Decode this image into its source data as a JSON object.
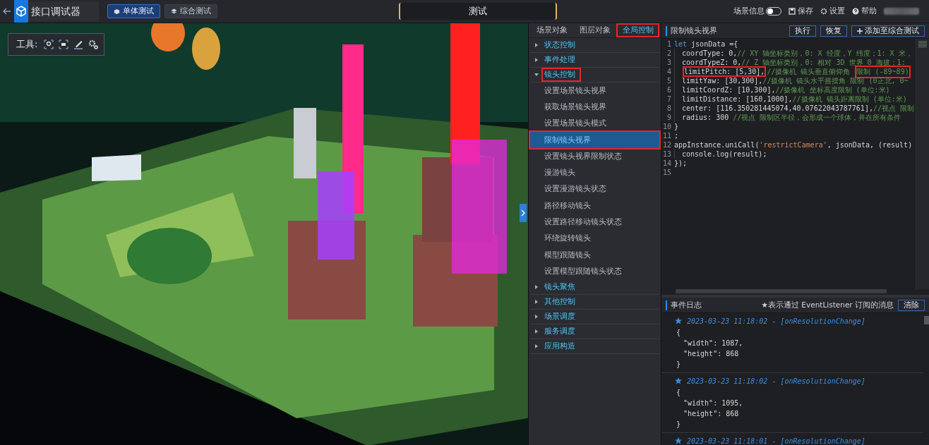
{
  "topbar": {
    "title": "接口调试器",
    "modes": [
      {
        "label": "单体测试",
        "selected": true
      },
      {
        "label": "综合测试",
        "selected": false
      }
    ],
    "page_title": "测试",
    "scene_info": {
      "label": "场景信息",
      "on": false
    },
    "actions": [
      {
        "kind": "save",
        "label": "保存"
      },
      {
        "kind": "settings",
        "label": "设置"
      },
      {
        "kind": "help",
        "label": "帮助"
      }
    ]
  },
  "viewport": {
    "kind": "picture",
    "tools_label": "工具:"
  },
  "panel_tabs": [
    {
      "label": "场景对象",
      "selected": false,
      "highlighted": false
    },
    {
      "label": "图层对象",
      "selected": false,
      "highlighted": false
    },
    {
      "label": "全局控制",
      "selected": true,
      "highlighted": true
    }
  ],
  "tree": [
    {
      "label": "状态控制",
      "expanded": false,
      "highlighted": false
    },
    {
      "label": "事件处理",
      "expanded": false,
      "highlighted": false
    },
    {
      "label": "镜头控制",
      "expanded": true,
      "highlighted": true,
      "children": [
        {
          "label": "设置场景镜头视界",
          "selected": false,
          "highlighted": false
        },
        {
          "label": "获取场景镜头视界",
          "selected": false,
          "highlighted": false
        },
        {
          "label": "设置场景镜头模式",
          "selected": false,
          "highlighted": false
        },
        {
          "label": "限制镜头视界",
          "selected": true,
          "highlighted": true
        },
        {
          "label": "设置镜头视界限制状态",
          "selected": false,
          "highlighted": false
        },
        {
          "label": "漫游镜头",
          "selected": false,
          "highlighted": false
        },
        {
          "label": "设置漫游镜头状态",
          "selected": false,
          "highlighted": false
        },
        {
          "label": "路径移动镜头",
          "selected": false,
          "highlighted": false
        },
        {
          "label": "设置路径移动镜头状态",
          "selected": false,
          "highlighted": false
        },
        {
          "label": "环绕旋转镜头",
          "selected": false,
          "highlighted": false
        },
        {
          "label": "模型跟随镜头",
          "selected": false,
          "highlighted": false
        },
        {
          "label": "设置模型跟随镜头状态",
          "selected": false,
          "highlighted": false
        }
      ]
    },
    {
      "label": "镜头聚焦",
      "expanded": false,
      "highlighted": false
    },
    {
      "label": "其他控制",
      "expanded": false,
      "highlighted": false
    },
    {
      "label": "场景调度",
      "expanded": false,
      "highlighted": false
    },
    {
      "label": "服务调度",
      "expanded": false,
      "highlighted": false
    },
    {
      "label": "应用构造",
      "expanded": false,
      "highlighted": false
    }
  ],
  "editor": {
    "title": "限制镜头视界",
    "buttons": [
      {
        "kind": "plain",
        "label": "执行"
      },
      {
        "kind": "plain",
        "label": "恢复"
      },
      {
        "kind": "add",
        "label": "添加至综合测试"
      }
    ],
    "lines": [
      {
        "number": "1",
        "indent": false,
        "segments": [
          {
            "kind": "keyword",
            "text": "let",
            "highlighted": false
          },
          {
            "kind": "plain",
            "text": " jsonData ={",
            "highlighted": false
          }
        ]
      },
      {
        "number": "2",
        "indent": true,
        "segments": [
          {
            "kind": "plain",
            "text": "coordType: 0,",
            "highlighted": false
          },
          {
            "kind": "comment",
            "text": "// XY 轴坐标类别，0: X 经度，Y 纬度；1: X 米，",
            "highlighted": false
          }
        ]
      },
      {
        "number": "3",
        "indent": true,
        "segments": [
          {
            "kind": "plain",
            "text": "coordTypeZ: 0,",
            "highlighted": false
          },
          {
            "kind": "comment",
            "text": "// Z 轴坐标类别，0: 相对 3D 世界 0 海拔；1:",
            "highlighted": false
          }
        ]
      },
      {
        "number": "4",
        "indent": true,
        "segments": [
          {
            "kind": "plain",
            "text": "limitPitch: [5,30],",
            "highlighted": true
          },
          {
            "kind": "comment",
            "text": "//摄像机 镜头垂直俯仰角 ",
            "highlighted": false
          },
          {
            "kind": "comment",
            "text": "限制 (-89~89)",
            "highlighted": true
          }
        ]
      },
      {
        "number": "5",
        "indent": true,
        "segments": [
          {
            "kind": "plain",
            "text": "limitYaw: [30,300],",
            "highlighted": false
          },
          {
            "kind": "comment",
            "text": "//摄像机 镜头水平摇摆角 限制 (0正北, 0~",
            "highlighted": false
          }
        ]
      },
      {
        "number": "6",
        "indent": true,
        "segments": [
          {
            "kind": "plain",
            "text": "limitCoordZ: [10,300],",
            "highlighted": false
          },
          {
            "kind": "comment",
            "text": "//摄像机 坐标高度限制 (单位:米)",
            "highlighted": false
          }
        ]
      },
      {
        "number": "7",
        "indent": true,
        "segments": [
          {
            "kind": "plain",
            "text": "limitDistance: [160,1000],",
            "highlighted": false
          },
          {
            "kind": "comment",
            "text": "//摄像机 镜头距离限制 (单位:米)",
            "highlighted": false
          }
        ]
      },
      {
        "number": "8",
        "indent": true,
        "segments": [
          {
            "kind": "plain",
            "text": "center: [116.350281445074,40.07622043787761],",
            "highlighted": false
          },
          {
            "kind": "comment",
            "text": "//视点 限制",
            "highlighted": false
          }
        ]
      },
      {
        "number": "9",
        "indent": true,
        "segments": [
          {
            "kind": "plain",
            "text": "radius: 300 ",
            "highlighted": false
          },
          {
            "kind": "comment",
            "text": "//视点 限制区半径，会形成一个球体，并在所有条件",
            "highlighted": false
          }
        ]
      },
      {
        "number": "10",
        "indent": false,
        "segments": [
          {
            "kind": "plain",
            "text": "}",
            "highlighted": false
          }
        ]
      },
      {
        "number": "11",
        "indent": false,
        "segments": [
          {
            "kind": "plain",
            "text": ";",
            "highlighted": false
          }
        ]
      },
      {
        "number": "12",
        "indent": false,
        "segments": [
          {
            "kind": "plain",
            "text": "appInstance.uniCall(",
            "highlighted": false
          },
          {
            "kind": "string",
            "text": "'restrictCamera'",
            "highlighted": false
          },
          {
            "kind": "plain",
            "text": ", jsonData, (result)",
            "highlighted": false
          }
        ]
      },
      {
        "number": "13",
        "indent": true,
        "segments": [
          {
            "kind": "plain",
            "text": "console.log(result);",
            "highlighted": false
          }
        ]
      },
      {
        "number": "14",
        "indent": false,
        "segments": [
          {
            "kind": "plain",
            "text": "});",
            "highlighted": false
          }
        ]
      },
      {
        "number": "15",
        "indent": false
      }
    ]
  },
  "log": {
    "title": "事件日志",
    "note": "★表示通过 EventListener 订阅的消息",
    "clear": "清除",
    "entries": [
      {
        "header": "2023-03-23 11:18:02 - [onResolutionChange]",
        "body": [
          "{",
          "\"width\": 1087,",
          "\"height\": 868",
          "}"
        ]
      },
      {
        "header": "2023-03-23 11:18:02 - [onResolutionChange]",
        "body": [
          "{",
          "\"width\": 1095,",
          "\"height\": 868",
          "}"
        ]
      },
      {
        "header": "2023-03-23 11:18:01 - [onResolutionChange]"
      }
    ]
  }
}
